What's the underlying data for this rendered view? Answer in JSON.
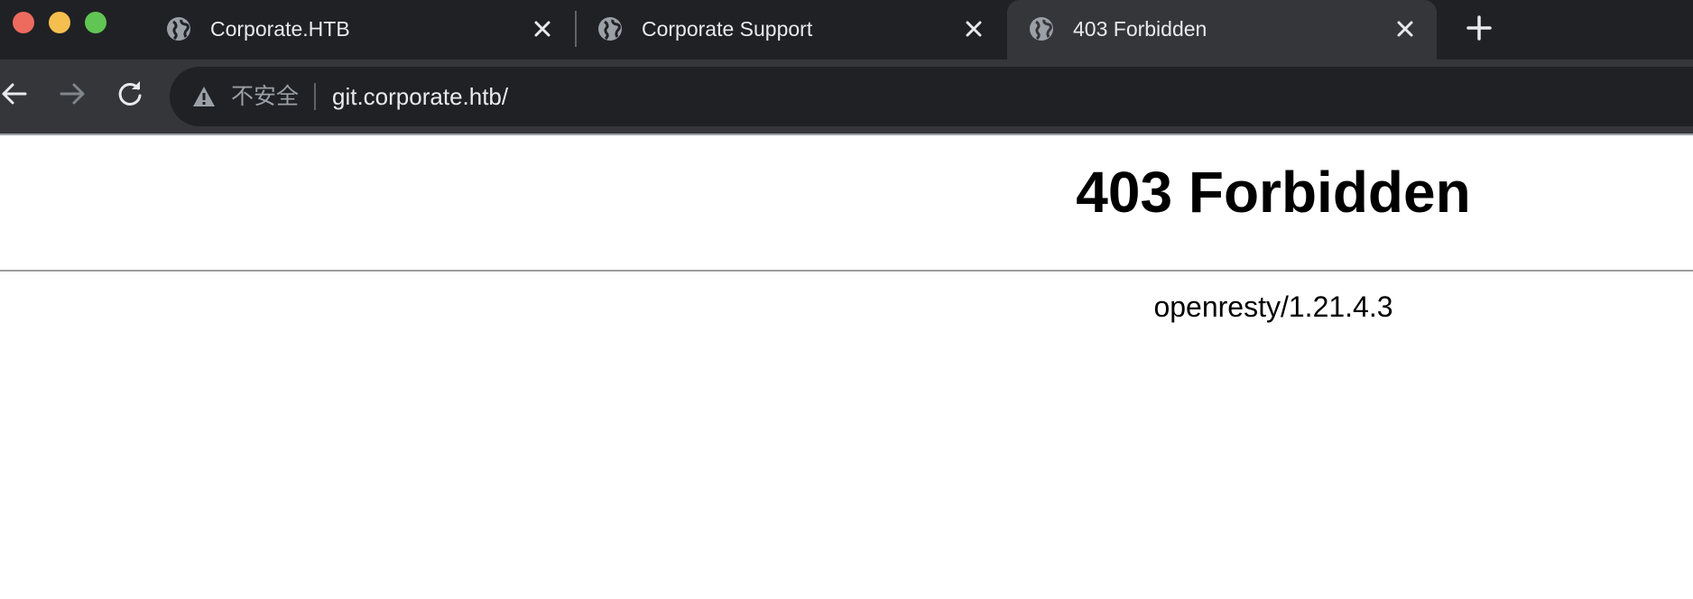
{
  "browser": {
    "tabs": [
      {
        "title": "Corporate.HTB",
        "icon": "globe-icon",
        "active": false
      },
      {
        "title": "Corporate Support",
        "icon": "globe-icon",
        "active": false
      },
      {
        "title": "403 Forbidden",
        "icon": "globe-icon",
        "active": true
      }
    ],
    "address_bar": {
      "security_label": "不安全",
      "url": "git.corporate.htb/"
    }
  },
  "page": {
    "heading": "403 Forbidden",
    "server": "openresty/1.21.4.3"
  },
  "colors": {
    "tabstrip": "#202124",
    "toolbar": "#35363a",
    "omnibox": "#202124",
    "tab_text": "#e8eaed",
    "security_text": "#9aa0a6"
  }
}
